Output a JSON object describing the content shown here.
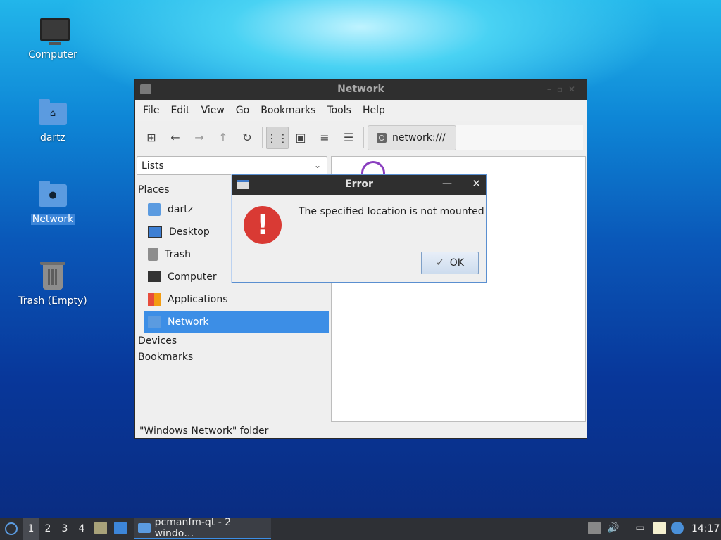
{
  "desktop": {
    "icons": [
      {
        "label": "Computer"
      },
      {
        "label": "dartz"
      },
      {
        "label": "Network"
      },
      {
        "label": "Trash (Empty)"
      }
    ]
  },
  "window": {
    "title": "Network",
    "menu": [
      "File",
      "Edit",
      "View",
      "Go",
      "Bookmarks",
      "Tools",
      "Help"
    ],
    "path": "network:///",
    "side_mode": "Lists",
    "sections": {
      "places": "Places",
      "devices": "Devices",
      "bookmarks": "Bookmarks"
    },
    "places": [
      {
        "label": "dartz",
        "icon": "home-folder-icon"
      },
      {
        "label": "Desktop",
        "icon": "desktop-icon"
      },
      {
        "label": "Trash",
        "icon": "trash-icon"
      },
      {
        "label": "Computer",
        "icon": "computer-icon"
      },
      {
        "label": "Applications",
        "icon": "applications-icon"
      },
      {
        "label": "Network",
        "icon": "network-icon"
      }
    ],
    "status": "\"Windows Network\" folder"
  },
  "dialog": {
    "title": "Error",
    "message": "The specified location is not mounted",
    "ok_label": "OK"
  },
  "taskbar": {
    "workspaces": [
      "1",
      "2",
      "3",
      "4"
    ],
    "active_window": "pcmanfm-qt - 2 windo…",
    "clock": "14:17"
  },
  "colors": {
    "accent": "#3c8ee6",
    "error": "#d93a34"
  }
}
